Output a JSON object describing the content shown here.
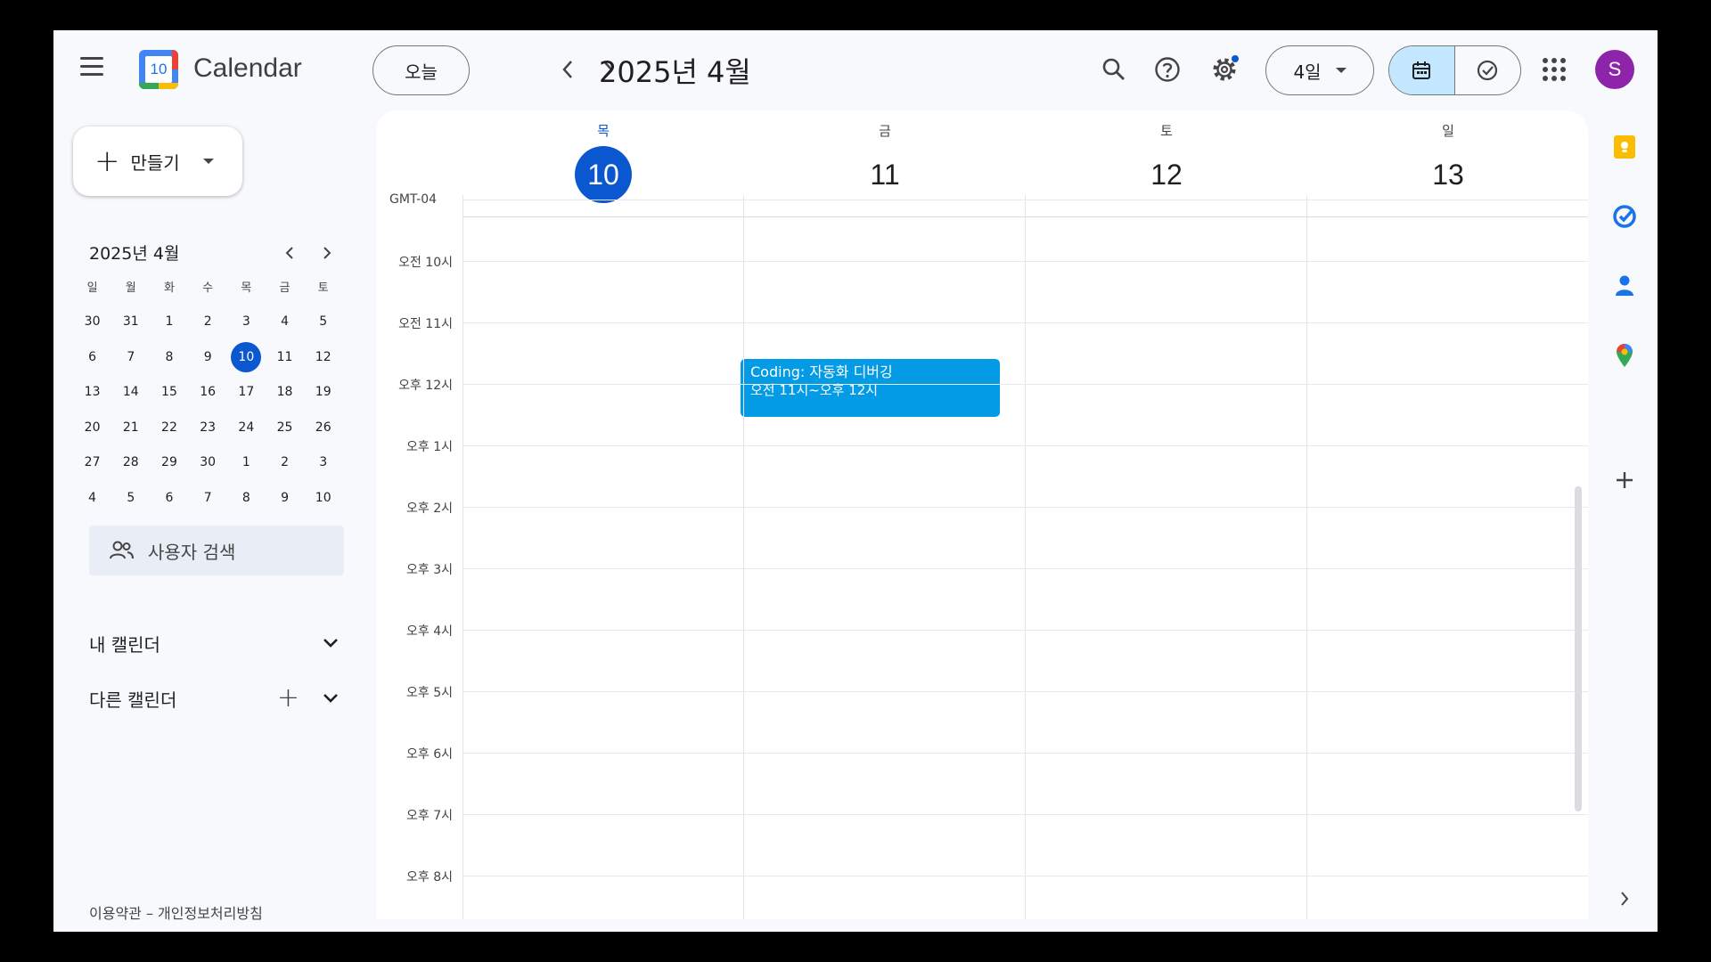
{
  "app": {
    "title": "Calendar",
    "logo_day": "10",
    "user_initial": "S"
  },
  "header": {
    "today_label": "오늘",
    "prev_label": "‹",
    "next_label": "›",
    "current_period": "2025년 4월",
    "view_label": "4일"
  },
  "sidebar": {
    "create_label": "만들기",
    "mini_calendar": {
      "title": "2025년 4월",
      "weekdays": [
        "일",
        "월",
        "화",
        "수",
        "목",
        "금",
        "토"
      ],
      "weeks": [
        [
          "30",
          "31",
          "1",
          "2",
          "3",
          "4",
          "5"
        ],
        [
          "6",
          "7",
          "8",
          "9",
          "10",
          "11",
          "12"
        ],
        [
          "13",
          "14",
          "15",
          "16",
          "17",
          "18",
          "19"
        ],
        [
          "20",
          "21",
          "22",
          "23",
          "24",
          "25",
          "26"
        ],
        [
          "27",
          "28",
          "29",
          "30",
          "1",
          "2",
          "3"
        ],
        [
          "4",
          "5",
          "6",
          "7",
          "8",
          "9",
          "10"
        ]
      ],
      "selected_date": "10"
    },
    "people_search_placeholder": "사용자 검색",
    "my_calendars": "내 캘린더",
    "other_calendars": "다른 캘린더",
    "footer": "이용약관 – 개인정보처리방침"
  },
  "calendar": {
    "timezone": "GMT-04",
    "days": [
      {
        "dow": "목",
        "date": "10",
        "today": true
      },
      {
        "dow": "금",
        "date": "11",
        "today": false
      },
      {
        "dow": "토",
        "date": "12",
        "today": false
      },
      {
        "dow": "일",
        "date": "13",
        "today": false
      }
    ],
    "hours": [
      "오전 10시",
      "오전 11시",
      "오후 12시",
      "오후 1시",
      "오후 2시",
      "오후 3시",
      "오후 4시",
      "오후 5시",
      "오후 6시",
      "오후 7시",
      "오후 8시"
    ],
    "events": [
      {
        "title": "Coding: 자동화 디버깅",
        "time": "오전 11시~오후 12시",
        "day": "11",
        "color": "#039be5"
      }
    ]
  },
  "colors": {
    "accent": "#0b57d0",
    "event": "#039be5",
    "avatar": "#8e24aa"
  }
}
